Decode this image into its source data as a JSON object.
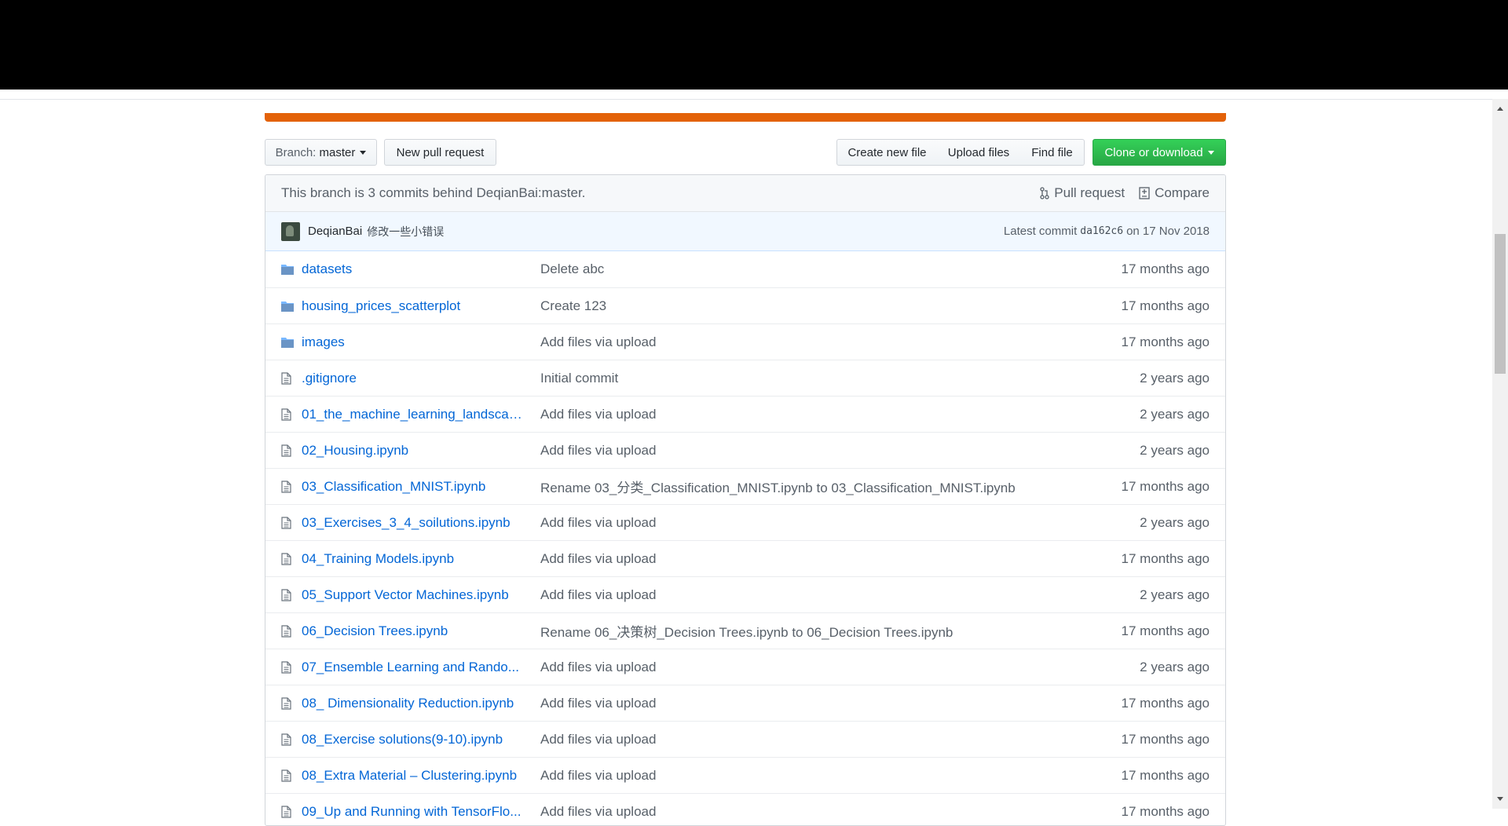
{
  "toolbar": {
    "branch_label": "Branch:",
    "branch_value": "master",
    "new_pull_request": "New pull request",
    "create_new_file": "Create new file",
    "upload_files": "Upload files",
    "find_file": "Find file",
    "clone_or_download": "Clone or download"
  },
  "branch_info": {
    "text": "This branch is 3 commits behind DeqianBai:master.",
    "pull_request": "Pull request",
    "compare": "Compare"
  },
  "commit": {
    "author": "DeqianBai",
    "message": "修改一些小错误",
    "latest_prefix": "Latest commit",
    "sha": "da162c6",
    "date": "on 17 Nov 2018"
  },
  "files": [
    {
      "type": "folder",
      "name": "datasets",
      "message": "Delete abc",
      "age": "17 months ago"
    },
    {
      "type": "folder",
      "name": "housing_prices_scatterplot",
      "message": "Create 123",
      "age": "17 months ago"
    },
    {
      "type": "folder",
      "name": "images",
      "message": "Add files via upload",
      "age": "17 months ago"
    },
    {
      "type": "file",
      "name": ".gitignore",
      "message": "Initial commit",
      "age": "2 years ago"
    },
    {
      "type": "file",
      "name": "01_the_machine_learning_landscap...",
      "message": "Add files via upload",
      "age": "2 years ago"
    },
    {
      "type": "file",
      "name": "02_Housing.ipynb",
      "message": "Add files via upload",
      "age": "2 years ago"
    },
    {
      "type": "file",
      "name": "03_Classification_MNIST.ipynb",
      "message": "Rename 03_分类_Classification_MNIST.ipynb to 03_Classification_MNIST.ipynb",
      "age": "17 months ago"
    },
    {
      "type": "file",
      "name": "03_Exercises_3_4_soilutions.ipynb",
      "message": "Add files via upload",
      "age": "2 years ago"
    },
    {
      "type": "file",
      "name": "04_Training Models.ipynb",
      "message": "Add files via upload",
      "age": "17 months ago"
    },
    {
      "type": "file",
      "name": "05_Support Vector Machines.ipynb",
      "message": "Add files via upload",
      "age": "2 years ago"
    },
    {
      "type": "file",
      "name": "06_Decision Trees.ipynb",
      "message": "Rename 06_决策树_Decision Trees.ipynb to 06_Decision Trees.ipynb",
      "age": "17 months ago"
    },
    {
      "type": "file",
      "name": "07_Ensemble Learning and Rando...",
      "message": "Add files via upload",
      "age": "2 years ago"
    },
    {
      "type": "file",
      "name": "08_ Dimensionality Reduction.ipynb",
      "message": "Add files via upload",
      "age": "17 months ago"
    },
    {
      "type": "file",
      "name": "08_Exercise solutions(9-10).ipynb",
      "message": "Add files via upload",
      "age": "17 months ago"
    },
    {
      "type": "file",
      "name": "08_Extra Material – Clustering.ipynb",
      "message": "Add files via upload",
      "age": "17 months ago"
    },
    {
      "type": "file",
      "name": "09_Up and Running with TensorFlo...",
      "message": "Add files via upload",
      "age": "17 months ago"
    }
  ]
}
